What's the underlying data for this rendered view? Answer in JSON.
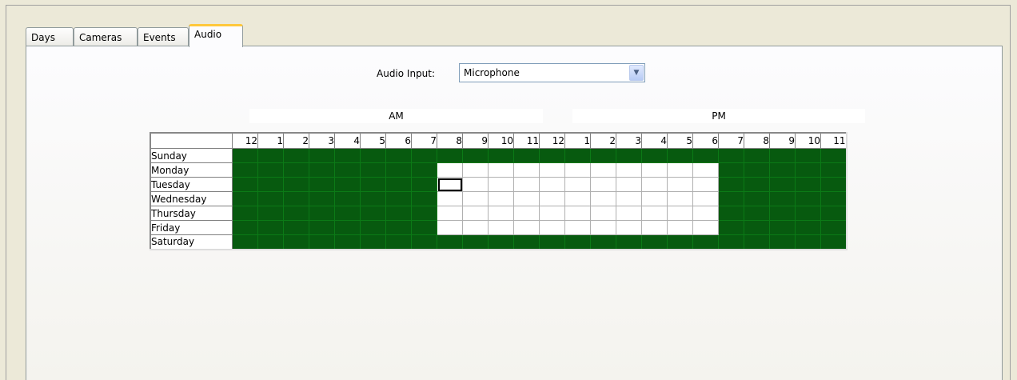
{
  "tabs": [
    "Days",
    "Cameras",
    "Events",
    "Audio"
  ],
  "active_tab": "Audio",
  "audio_input": {
    "label": "Audio Input:",
    "value": "Microphone"
  },
  "periods": [
    "AM",
    "PM"
  ],
  "hours": [
    "12",
    "1",
    "2",
    "3",
    "4",
    "5",
    "6",
    "7",
    "8",
    "9",
    "10",
    "11",
    "12",
    "1",
    "2",
    "3",
    "4",
    "5",
    "6",
    "7",
    "8",
    "9",
    "10",
    "11"
  ],
  "days": [
    {
      "name": "Sunday",
      "schedule": "111111111111111111111111"
    },
    {
      "name": "Monday",
      "schedule": "111111110000000000011111"
    },
    {
      "name": "Tuesday",
      "schedule": "111111110000000000011111"
    },
    {
      "name": "Wednesday",
      "schedule": "111111110000000000011111"
    },
    {
      "name": "Thursday",
      "schedule": "111111110000000000011111"
    },
    {
      "name": "Friday",
      "schedule": "111111110000000000011111"
    },
    {
      "name": "Saturday",
      "schedule": "111111111111111111111111"
    }
  ],
  "selected_cell": {
    "day": "Tuesday",
    "hour_index": 8
  },
  "colors": {
    "scheduled": "#075a0f",
    "unscheduled": "#ffffff",
    "active_tab_accent": "#ffc83c"
  }
}
